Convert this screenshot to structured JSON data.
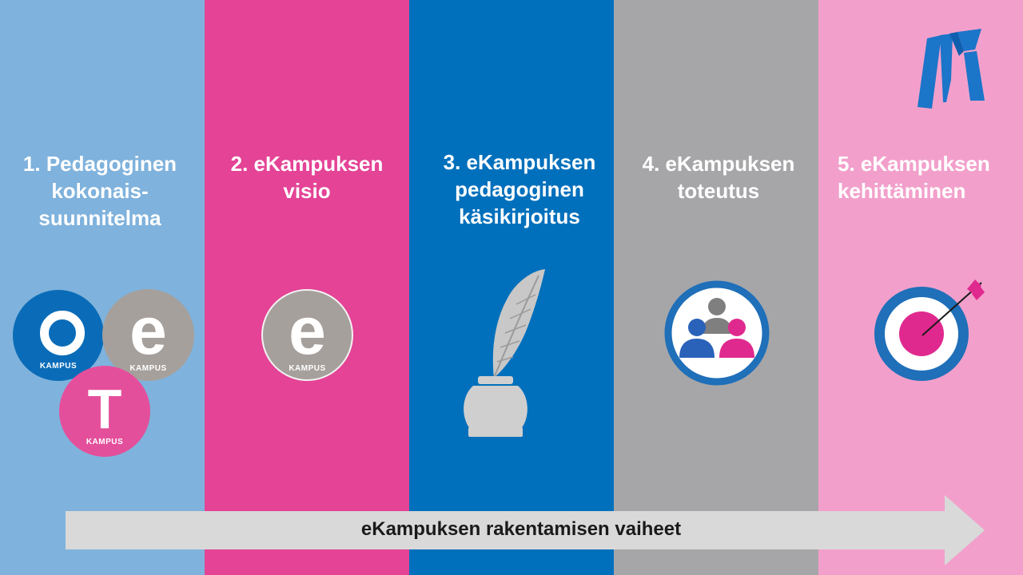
{
  "colors": {
    "col1": "#7fb2dc",
    "col2": "#e44396",
    "col3": "#0070bc",
    "col4": "#a6a6a8",
    "col5": "#f2a0cb",
    "arrow": "#d9d9d9"
  },
  "columns": [
    {
      "title_lines": [
        "1. Pedagoginen",
        "kokonais-",
        "suunnitelma"
      ]
    },
    {
      "title_lines": [
        "2. eKampuksen",
        "visio"
      ]
    },
    {
      "title_lines": [
        "3. eKampuksen",
        "pedagoginen",
        "käsikirjoitus"
      ]
    },
    {
      "title_lines": [
        "4. eKampuksen",
        "toteutus"
      ]
    },
    {
      "title_lines": [
        "5. eKampuksen",
        "kehittäminen"
      ]
    }
  ],
  "badges": {
    "o": {
      "letter": "O",
      "label": "KAMPUS"
    },
    "e1": {
      "letter": "e",
      "label": "KAMPUS"
    },
    "t": {
      "letter": "T",
      "label": "KAMPUS"
    },
    "e2": {
      "letter": "e",
      "label": "KAMPUS"
    }
  },
  "icons": {
    "logo": "brand-logo-icon",
    "quill": "quill-and-inkwell-icon",
    "team": "team-people-icon",
    "target": "target-arrow-icon"
  },
  "arrow_label": "eKampuksen rakentamisen vaiheet"
}
